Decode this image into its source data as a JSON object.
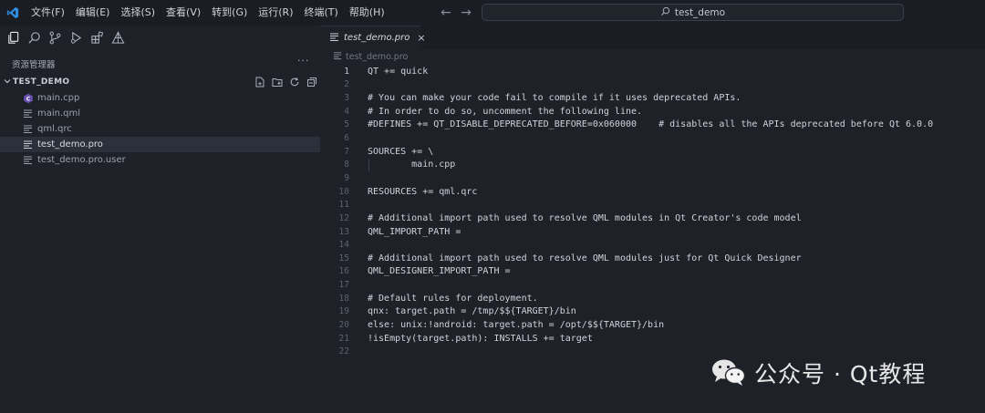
{
  "window": {
    "menu": [
      "文件(F)",
      "编辑(E)",
      "选择(S)",
      "查看(V)",
      "转到(G)",
      "运行(R)",
      "终端(T)",
      "帮助(H)"
    ],
    "search_label": "test_demo"
  },
  "sidebar": {
    "title": "资源管理器",
    "more": "···",
    "project_name": "TEST_DEMO",
    "files": [
      {
        "name": "main.cpp",
        "icon": "cpp-file-icon"
      },
      {
        "name": "main.qml",
        "icon": "text-file-icon"
      },
      {
        "name": "qml.qrc",
        "icon": "text-file-icon"
      },
      {
        "name": "test_demo.pro",
        "icon": "text-file-icon",
        "selected": true
      },
      {
        "name": "test_demo.pro.user",
        "icon": "text-file-icon"
      }
    ]
  },
  "editor": {
    "tab_label": "test_demo.pro",
    "tab_close": "×",
    "breadcrumb": "test_demo.pro",
    "lines": [
      {
        "n": "1",
        "text": "QT += quick"
      },
      {
        "n": "2",
        "text": ""
      },
      {
        "n": "3",
        "text": "# You can make your code fail to compile if it uses deprecated APIs."
      },
      {
        "n": "4",
        "text": "# In order to do so, uncomment the following line."
      },
      {
        "n": "5",
        "text": "#DEFINES += QT_DISABLE_DEPRECATED_BEFORE=0x060000    # disables all the APIs deprecated before Qt 6.0.0"
      },
      {
        "n": "6",
        "text": ""
      },
      {
        "n": "7",
        "text": "SOURCES += \\"
      },
      {
        "n": "8",
        "text": "        main.cpp"
      },
      {
        "n": "9",
        "text": ""
      },
      {
        "n": "10",
        "text": "RESOURCES += qml.qrc"
      },
      {
        "n": "11",
        "text": ""
      },
      {
        "n": "12",
        "text": "# Additional import path used to resolve QML modules in Qt Creator's code model"
      },
      {
        "n": "13",
        "text": "QML_IMPORT_PATH ="
      },
      {
        "n": "14",
        "text": ""
      },
      {
        "n": "15",
        "text": "# Additional import path used to resolve QML modules just for Qt Quick Designer"
      },
      {
        "n": "16",
        "text": "QML_DESIGNER_IMPORT_PATH ="
      },
      {
        "n": "17",
        "text": ""
      },
      {
        "n": "18",
        "text": "# Default rules for deployment."
      },
      {
        "n": "19",
        "text": "qnx: target.path = /tmp/$${TARGET}/bin"
      },
      {
        "n": "20",
        "text": "else: unix:!android: target.path = /opt/$${TARGET}/bin"
      },
      {
        "n": "21",
        "text": "!isEmpty(target.path): INSTALLS += target"
      },
      {
        "n": "22",
        "text": ""
      }
    ]
  },
  "watermark": {
    "text": "公众号 · Qt教程"
  }
}
